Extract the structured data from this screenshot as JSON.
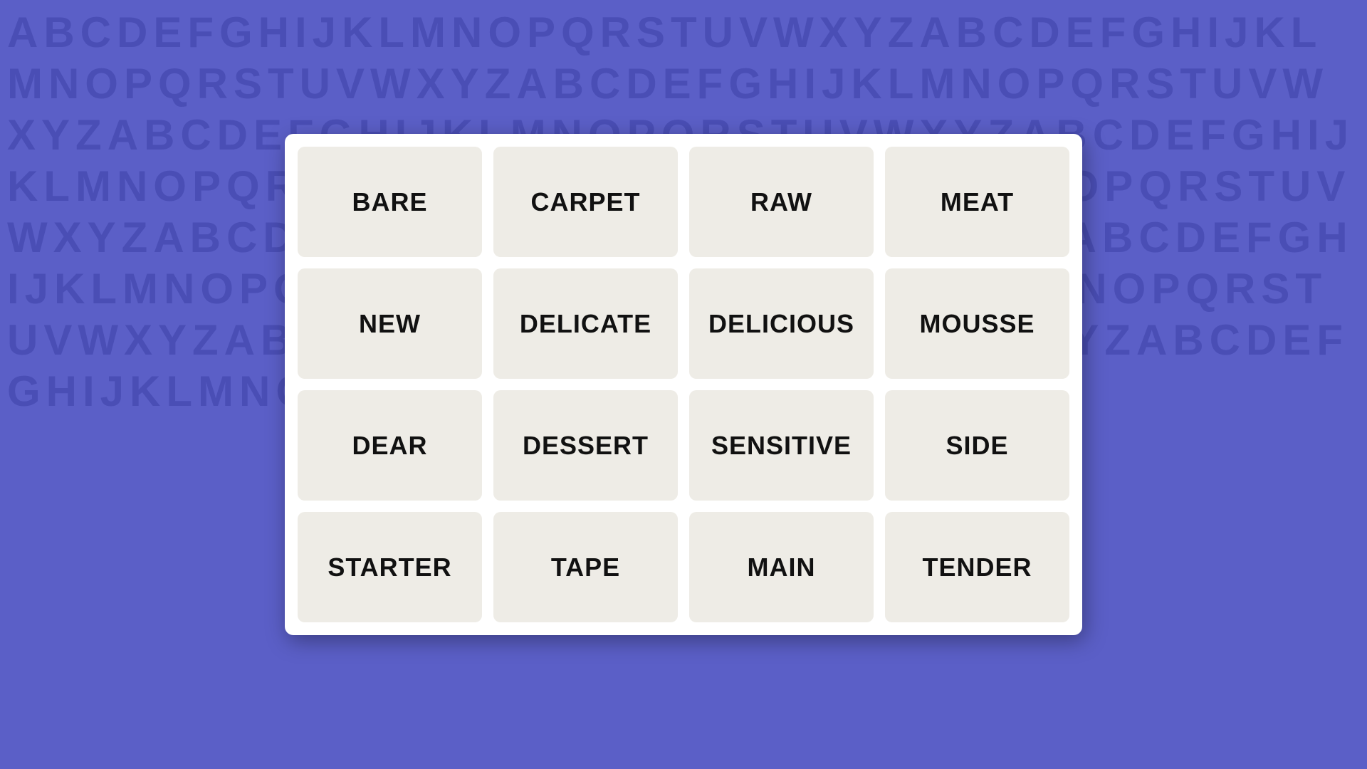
{
  "background": {
    "letters": "ABCDEFGHIJKLMNOPQRSTUVWXYZABCDEFGHIJKLMNOPQRSTUVWXYZABCDEFGHIJKLMNOPQRSTUVWXYZABCDEFGHIJKLMNOPQRSTUVWXYZABCDEFGHIJKLMNOPQRSTUVWXYZABCDEFGHIJKLMNOPQRSTUVWXYZABCDEFGHIJKLMNOPQRSTUVWXYZABCDEFGHIJKLMNOPQRSTUVWXYZABCDEFGHIJKLMNOPQRSTUVWXYZABCDEFGHIJKLMNOPQRSTUVWXYZABCDEFGHIJKLMNOPQRSTUVWXYZ"
  },
  "words": [
    "BARE",
    "CARPET",
    "RAW",
    "MEAT",
    "NEW",
    "DELICATE",
    "DELICIOUS",
    "MOUSSE",
    "DEAR",
    "DESSERT",
    "SENSITIVE",
    "SIDE",
    "STARTER",
    "TAPE",
    "MAIN",
    "TENDER"
  ]
}
